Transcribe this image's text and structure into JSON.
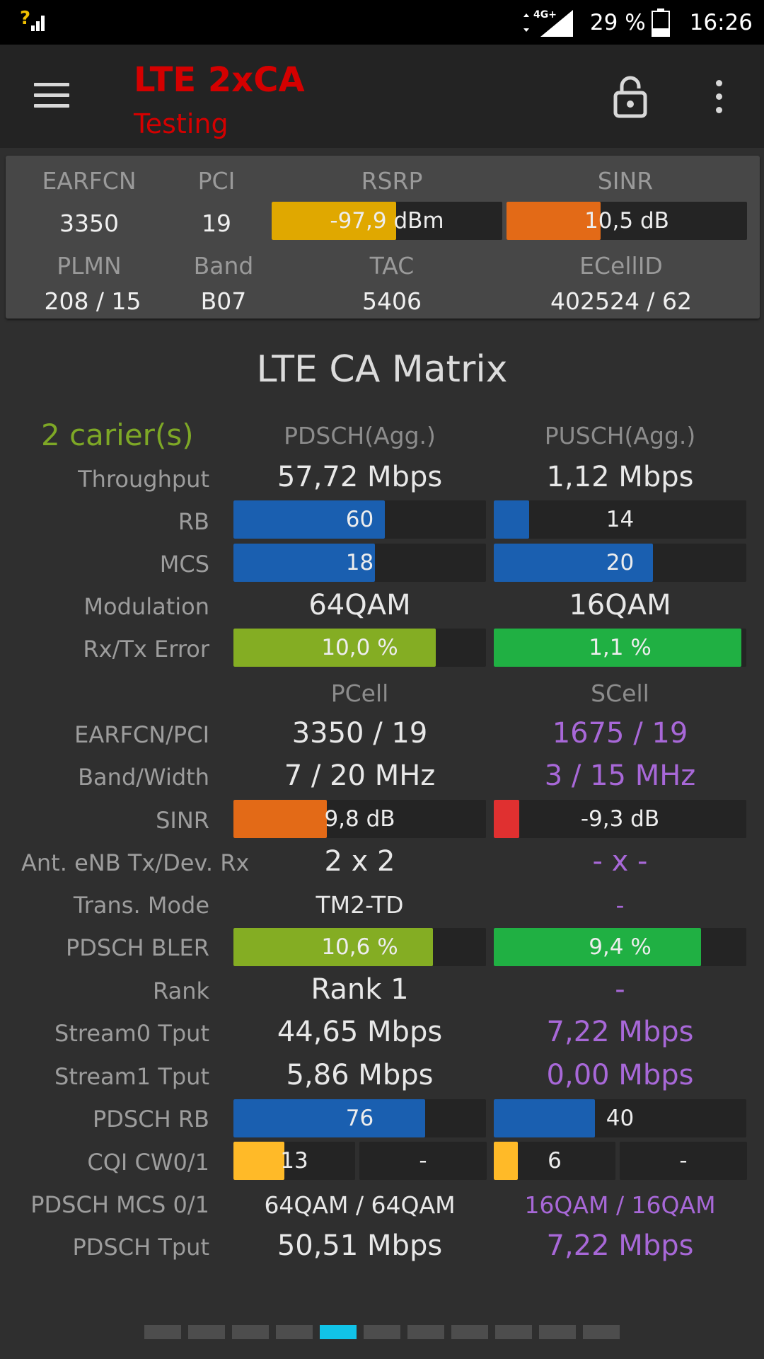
{
  "status_bar": {
    "signal_icon": "signal-question-icon",
    "network": "4G+",
    "battery": "29 %",
    "time": "16:26"
  },
  "app_bar": {
    "title": "LTE 2xCA",
    "subtitle": "Testing"
  },
  "summary": {
    "earfcn_label": "EARFCN",
    "pci_label": "PCI",
    "rsrp_label": "RSRP",
    "sinr_label": "SINR",
    "earfcn": "3350",
    "pci": "19",
    "rsrp": {
      "text": "-97,9 dBm",
      "fill": 0.54,
      "color": "#e0a800"
    },
    "sinr": {
      "text": "10,5 dB",
      "fill": 0.39,
      "color": "#e36a17"
    },
    "plmn_label": "PLMN",
    "band_label": "Band",
    "tac_label": "TAC",
    "ecellid_label": "ECellID",
    "plmn": "208 / 15",
    "band": "B07",
    "tac": "5406",
    "ecellid": "402524 / 62"
  },
  "matrix": {
    "title": "LTE CA Matrix",
    "carriers": "2 carier(s)",
    "pdsch_header": "PDSCH(Agg.)",
    "pusch_header": "PUSCH(Agg.)",
    "labels": {
      "throughput": "Throughput",
      "rb": "RB",
      "mcs": "MCS",
      "modulation": "Modulation",
      "rxtx_error": "Rx/Tx Error",
      "earfcn_pci": "EARFCN/PCI",
      "band_width": "Band/Width",
      "sinr": "SINR",
      "antennas": "Ant. eNB Tx/Dev. Rx",
      "trans_mode": "Trans. Mode",
      "pdsch_bler": "PDSCH BLER",
      "rank": "Rank",
      "stream0": "Stream0 Tput",
      "stream1": "Stream1 Tput",
      "pdsch_rb": "PDSCH RB",
      "cqi": "CQI CW0/1",
      "pdsch_mcs": "PDSCH MCS 0/1",
      "pdsch_tput": "PDSCH Tput"
    },
    "agg": {
      "dl_throughput": "57,72 Mbps",
      "ul_throughput": "1,12 Mbps",
      "dl_rb": {
        "text": "60",
        "fill": 0.6,
        "color": "#1a5fb0"
      },
      "ul_rb": {
        "text": "14",
        "fill": 0.14,
        "color": "#1a5fb0"
      },
      "dl_mcs": {
        "text": "18",
        "fill": 0.56,
        "color": "#1a5fb0"
      },
      "ul_mcs": {
        "text": "20",
        "fill": 0.63,
        "color": "#1a5fb0"
      },
      "dl_modulation": "64QAM",
      "ul_modulation": "16QAM",
      "dl_error": {
        "text": "10,0 %",
        "fill": 0.8,
        "color": "#84ad23"
      },
      "ul_error": {
        "text": "1,1 %",
        "fill": 0.98,
        "color": "#20b043"
      }
    },
    "pcell_header": "PCell",
    "scell_header": "SCell",
    "pcell": {
      "earfcn_pci": "3350 / 19",
      "band_width": "7 / 20 MHz",
      "sinr": {
        "text": "9,8 dB",
        "fill": 0.37,
        "color": "#e36a17"
      },
      "antennas": "2 x 2",
      "trans_mode": "TM2-TD",
      "bler": {
        "text": "10,6 %",
        "fill": 0.79,
        "color": "#84ad23"
      },
      "rank": "Rank 1",
      "stream0": "44,65 Mbps",
      "stream1": "5,86 Mbps",
      "pdsch_rb": {
        "text": "76",
        "fill": 0.76,
        "color": "#1a5fb0"
      },
      "cqi0": {
        "text": "13",
        "fill": 0.42,
        "color": "#ffba28"
      },
      "cqi1": "-",
      "pdsch_mcs": "64QAM / 64QAM",
      "pdsch_tput": "50,51 Mbps"
    },
    "scell": {
      "earfcn_pci": "1675 / 19",
      "band_width": "3 / 15 MHz",
      "sinr": {
        "text": "-9,3 dB",
        "fill": 0.1,
        "color": "#e03030"
      },
      "antennas": "- x -",
      "trans_mode": "-",
      "bler": {
        "text": "9,4 %",
        "fill": 0.82,
        "color": "#20b043"
      },
      "rank": "-",
      "stream0": "7,22 Mbps",
      "stream1": "0,00 Mbps",
      "pdsch_rb": {
        "text": "40",
        "fill": 0.4,
        "color": "#1a5fb0"
      },
      "cqi0": {
        "text": "6",
        "fill": 0.2,
        "color": "#ffba28"
      },
      "cqi1": "-",
      "pdsch_mcs": "16QAM / 16QAM",
      "pdsch_tput": "7,22 Mbps"
    }
  },
  "pager": {
    "page": 5,
    "pages": 11
  }
}
